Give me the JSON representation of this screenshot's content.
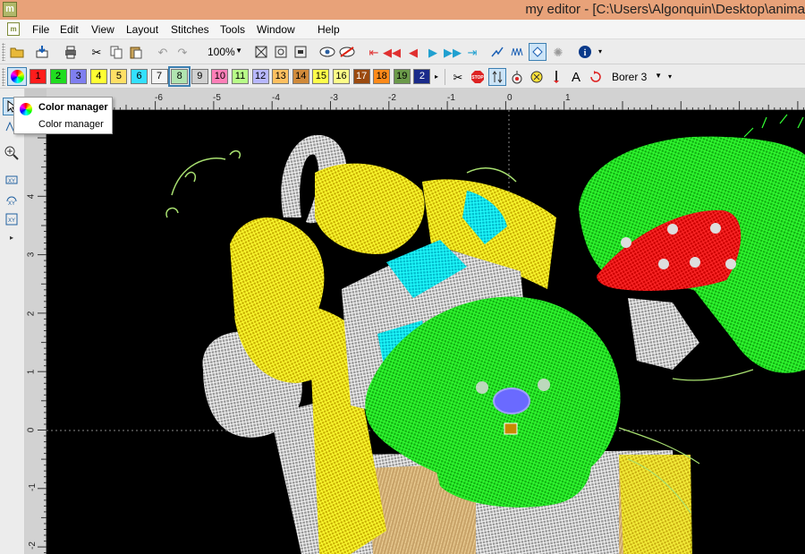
{
  "window": {
    "title": "my editor - [C:\\Users\\Algonquin\\Desktop\\anima",
    "app_icon": "m"
  },
  "menu": {
    "doc_icon": "m",
    "items": [
      "File",
      "Edit",
      "View",
      "Layout",
      "Stitches",
      "Tools",
      "Window",
      "Help"
    ]
  },
  "toolbar1": {
    "zoom_value": "100%"
  },
  "toolbar2": {
    "colors": [
      {
        "label": "1",
        "hex": "#ff1c1c"
      },
      {
        "label": "2",
        "hex": "#20dd20"
      },
      {
        "label": "3",
        "hex": "#7f7ff0"
      },
      {
        "label": "4",
        "hex": "#ffff33"
      },
      {
        "label": "5",
        "hex": "#ffe066"
      },
      {
        "label": "6",
        "hex": "#33e0ff"
      },
      {
        "label": "7",
        "hex": "#f4f4f4"
      },
      {
        "label": "8",
        "hex": "#b0e4b0"
      },
      {
        "label": "9",
        "hex": "#d0d0d0"
      },
      {
        "label": "10",
        "hex": "#ff7fb8"
      },
      {
        "label": "11",
        "hex": "#b8ff88"
      },
      {
        "label": "12",
        "hex": "#b8b8ff"
      },
      {
        "label": "13",
        "hex": "#ffc060"
      },
      {
        "label": "14",
        "hex": "#d08a3a"
      },
      {
        "label": "15",
        "hex": "#ffff4a"
      },
      {
        "label": "16",
        "hex": "#ffff88"
      },
      {
        "label": "17",
        "hex": "#9b4a10"
      },
      {
        "label": "18",
        "hex": "#ff8a1a"
      },
      {
        "label": "19",
        "hex": "#6b9a4a"
      },
      {
        "label": "2",
        "hex": "#1a2a8a"
      }
    ],
    "borer_value": "Borer 3"
  },
  "tooltip": {
    "title": "Color manager",
    "description": "Color manager"
  },
  "ruler": {
    "top_labels": [
      "-6",
      "-5",
      "-4",
      "-3",
      "-2",
      "-1",
      "0",
      "1"
    ],
    "left_labels": [
      "4",
      "3",
      "2",
      "1",
      "0",
      "-1",
      "-2"
    ]
  },
  "accent_colors": {
    "canvas": "#000000",
    "selection": "#cce4f7",
    "titlebar": "#e8a279"
  }
}
